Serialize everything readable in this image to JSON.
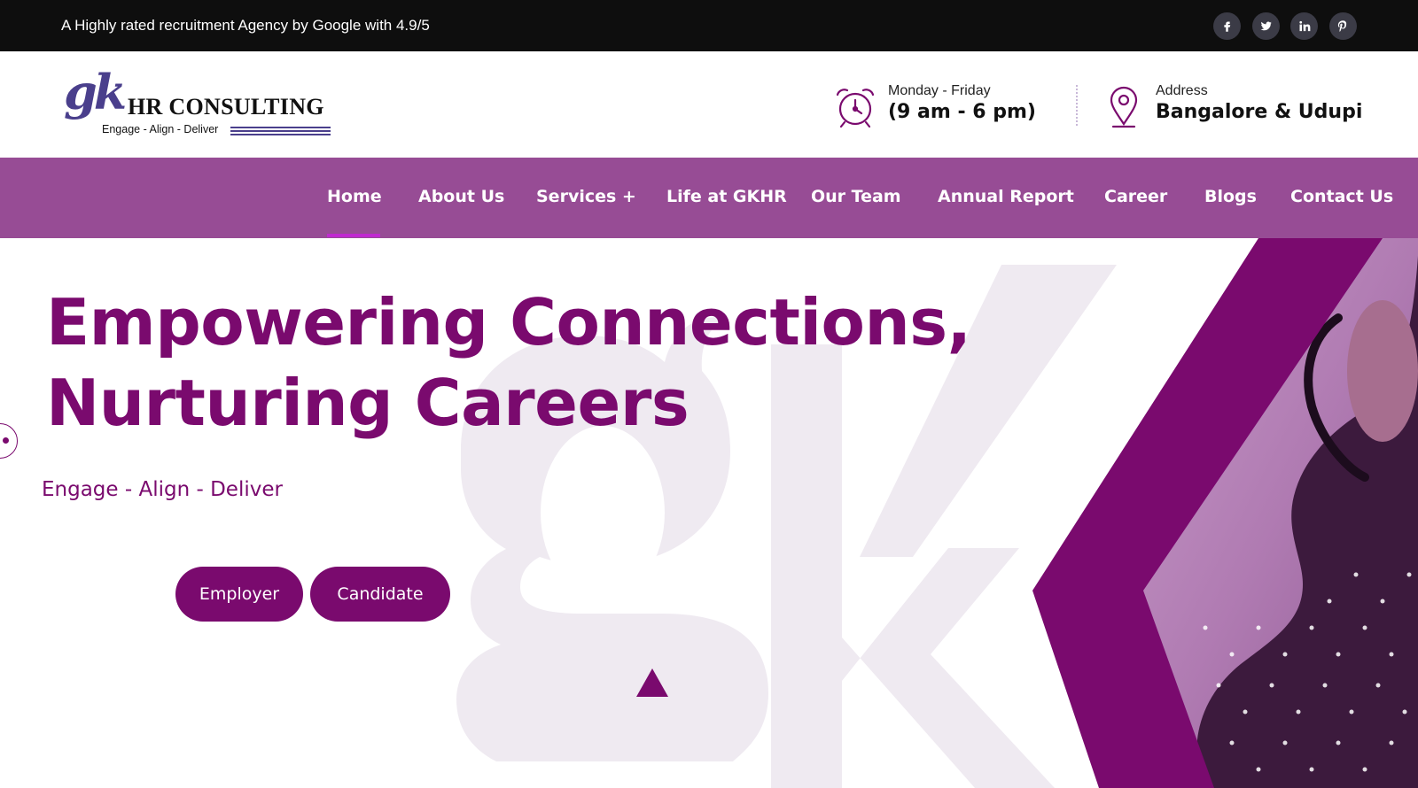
{
  "topbar": {
    "text": "A Highly rated recruitment Agency by Google with 4.9/5",
    "social": [
      {
        "icon": "facebook-icon"
      },
      {
        "icon": "twitter-icon"
      },
      {
        "icon": "linkedin-icon"
      },
      {
        "icon": "pinterest-icon"
      }
    ]
  },
  "header": {
    "logo": {
      "mark": "gk",
      "name": "HR CONSULTING",
      "tagline": "Engage - Align - Deliver"
    },
    "hours": {
      "icon": "alarm-clock-icon",
      "label": "Monday - Friday",
      "value": "(9 am - 6 pm)"
    },
    "address": {
      "icon": "location-pin-icon",
      "label": "Address",
      "value": "Bangalore & Udupi"
    }
  },
  "nav": {
    "items": [
      {
        "label": "Home",
        "active": true
      },
      {
        "label": "About Us"
      },
      {
        "label": "Services +"
      },
      {
        "label": "Life at GKHR"
      },
      {
        "label": "Our Team"
      },
      {
        "label": "Annual Report"
      },
      {
        "label": "Career"
      },
      {
        "label": "Blogs"
      },
      {
        "label": "Contact Us"
      }
    ]
  },
  "hero": {
    "title_line1": "Empowering Connections,",
    "title_line2": "Nurturing Careers",
    "subtitle": "Engage - Align - Deliver",
    "buttons": {
      "employer": "Employer",
      "candidate": "Candidate"
    }
  },
  "colors": {
    "brand": "#7a0a6e",
    "nav_bg": "#974c95",
    "topbar_bg": "#0e0e0e",
    "logo_blue": "#4a3f8c"
  }
}
